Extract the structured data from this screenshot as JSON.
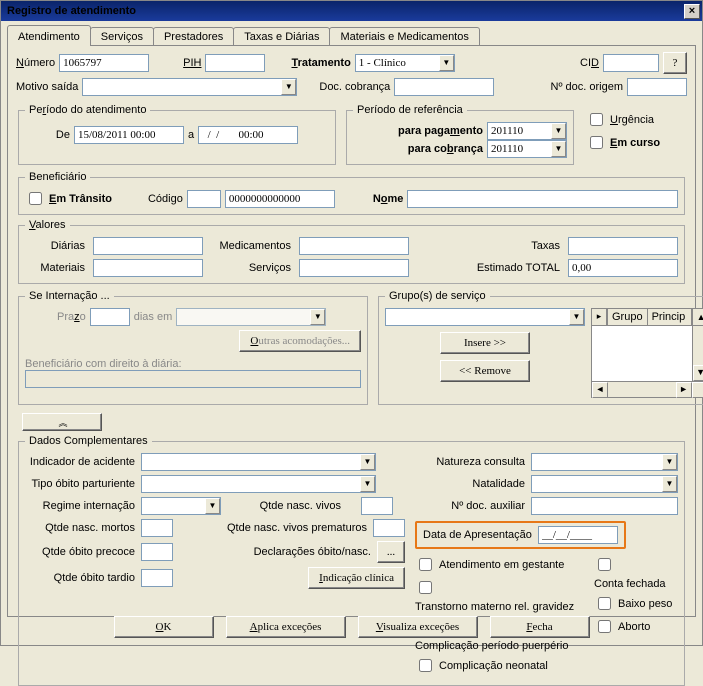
{
  "title": "Registro de atendimento",
  "tabs": [
    "Atendimento",
    "Serviços",
    "Prestadores",
    "Taxas e Diárias",
    "Materiais e Medicamentos"
  ],
  "top": {
    "numero_label": "Número",
    "numero": "1065797",
    "pih_label": "PIH",
    "pih": "",
    "tratamento_label": "Tratamento",
    "tratamento_value": "1 - Clínico",
    "cid_label": "CID",
    "cid": "",
    "q_btn": "?",
    "motivo_label": "Motivo saída",
    "doc_cobr_label": "Doc. cobrança",
    "doc_cobr": "",
    "ndoc_origem_label": "Nº doc. origem",
    "ndoc_origem": ""
  },
  "periodo_atend": {
    "legend": "Período do atendimento",
    "de": "De",
    "de_val": "15/08/2011 00:00",
    "a": "a",
    "a_val": "  /  /       00:00"
  },
  "periodo_ref": {
    "legend": "Período de referência",
    "pag_label": "para pagamento",
    "pag_val": "201110",
    "cob_label": "para cobrança",
    "cob_val": "201110"
  },
  "flags": {
    "urgencia": "Urgência",
    "em_curso": "Em curso"
  },
  "benef": {
    "legend": "Beneficiário",
    "em_transito": "Em Trânsito",
    "codigo_label": "Código",
    "codigo1": "",
    "codigo2": "0000000000000",
    "nome_label": "Nome",
    "nome": ""
  },
  "valores": {
    "legend": "Valores",
    "diarias_label": "Diárias",
    "materiais_label": "Materiais",
    "medic_label": "Medicamentos",
    "servicos_label": "Serviços",
    "taxas_label": "Taxas",
    "est_total_label": "Estimado TOTAL",
    "est_total": "0,00"
  },
  "internacao": {
    "legend": "Se Internação ...",
    "prazo_label": "Prazo",
    "dias_em": "dias em",
    "outras_btn": "Outras acomodações...",
    "benef_diaria": "Beneficiário com direito à diária:"
  },
  "grupos": {
    "legend": "Grupo(s) de serviço",
    "insere": "Insere >>",
    "remove": "<< Remove",
    "col_grupo": "Grupo",
    "col_princip": "Princip"
  },
  "expand_btn": "≈",
  "dados": {
    "legend": "Dados Complementares",
    "indicador_acidente": "Indicador de acidente",
    "tipo_obito_parturiente": "Tipo óbito parturiente",
    "regime_internacao": "Regime internação",
    "qtde_nasc_mortos": "Qtde nasc. mortos",
    "qtde_obito_precoce": "Qtde óbito precoce",
    "qtde_obito_tardio": "Qtde óbito tardio",
    "qtde_nasc_vivos": "Qtde nasc. vivos",
    "qtde_nasc_vivos_prematuros": "Qtde nasc. vivos prematuros",
    "declaracoes_btn_label": "Declarações óbito/nasc.",
    "declaracoes_btn": "...",
    "indicacao_btn": "Indicação clínica",
    "natureza_consulta": "Natureza consulta",
    "natalidade": "Natalidade",
    "ndoc_auxiliar": "Nº doc. auxiliar",
    "data_apresentacao_label": "Data de Apresentação",
    "data_apresentacao": "__/__/____",
    "chk_gestante": "Atendimento em gestante",
    "chk_transtorno": "Transtorno materno rel. gravidez",
    "chk_complic_puerperio": "Complicação período puerpério",
    "chk_complic_neonatal": "Complicação neonatal",
    "chk_conta_fechada": "Conta fechada",
    "chk_baixo_peso": "Baixo peso",
    "chk_aborto": "Aborto"
  },
  "footer": {
    "ok": "OK",
    "aplica": "Aplica exceções",
    "visualiza": "Visualiza exceções",
    "fecha": "Fecha"
  }
}
